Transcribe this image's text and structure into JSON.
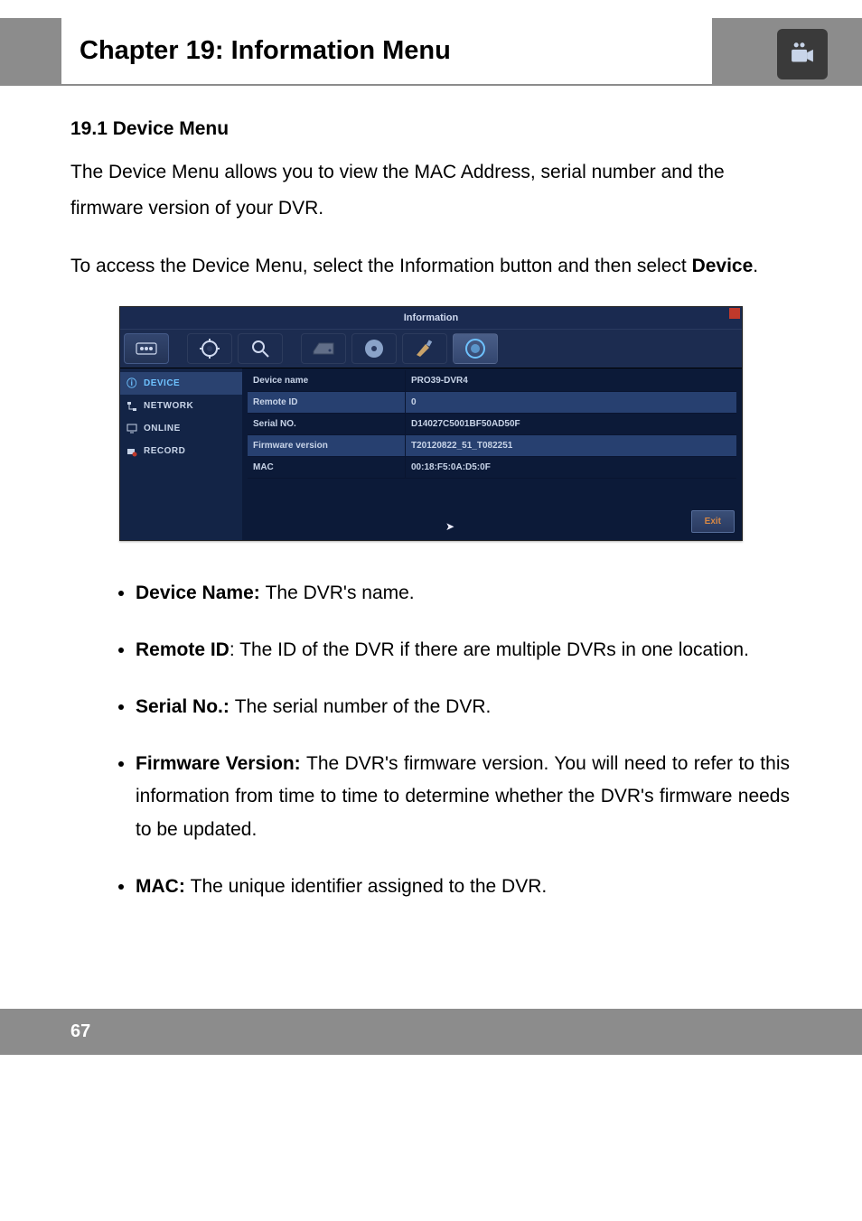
{
  "header": {
    "title": "Chapter 19: Information Menu"
  },
  "section": {
    "heading": "19.1 Device Menu",
    "para1": "The Device Menu allows you to view the MAC Address, serial number and the firmware version of your DVR.",
    "para2a": "To access the Device Menu, select the Information button and then select ",
    "para2b": "Device",
    "para2c": "."
  },
  "screenshot": {
    "title": "Information",
    "sidebar": [
      {
        "label": "DEVICE",
        "active": true
      },
      {
        "label": "NETWORK",
        "active": false
      },
      {
        "label": "ONLINE",
        "active": false
      },
      {
        "label": "RECORD",
        "active": false
      }
    ],
    "rows": [
      {
        "label": "Device name",
        "value": "PRO39-DVR4",
        "sel": false
      },
      {
        "label": "Remote ID",
        "value": "0",
        "sel": true
      },
      {
        "label": "Serial NO.",
        "value": "D14027C5001BF50AD50F",
        "sel": false
      },
      {
        "label": "Firmware version",
        "value": "T20120822_51_T082251",
        "sel": true
      },
      {
        "label": "MAC",
        "value": "00:18:F5:0A:D5:0F",
        "sel": false
      }
    ],
    "exit": "Exit"
  },
  "bullets": {
    "b1_strong": "Device Name: ",
    "b1_text": "The DVR's name.",
    "b2_strong": "Remote ID",
    "b2_text": ": The ID of the DVR if there are multiple DVRs in one location.",
    "b3_strong": "Serial No.: ",
    "b3_text": "The serial number of the DVR.",
    "b4_strong": "Firmware Version: ",
    "b4_text": "The DVR's firmware version. You will need to refer to this information from time to time to determine whether the DVR's firmware needs to be updated.",
    "b5_strong": "MAC: ",
    "b5_text": "The unique identifier assigned to the DVR."
  },
  "footer": {
    "page": "67"
  }
}
